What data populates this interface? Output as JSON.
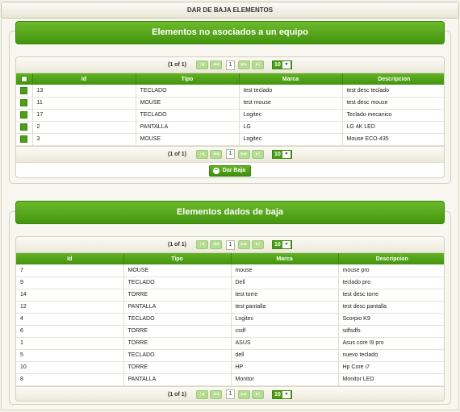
{
  "page": {
    "title": "DAR DE BAJA ELEMENTOS"
  },
  "panel1": {
    "title": "Elementos no asociados a un equipo",
    "pager": {
      "current": "(1 of 1)",
      "page": "1",
      "rows_per_page": "10"
    },
    "columns": [
      "Id",
      "Tipo",
      "Marca",
      "Descripcion"
    ],
    "rows": [
      {
        "id": "13",
        "tipo": "TECLADO",
        "marca": "test teclado",
        "descripcion": "test desc teclado"
      },
      {
        "id": "11",
        "tipo": "MOUSE",
        "marca": "test mouse",
        "descripcion": "test desc mouse"
      },
      {
        "id": "17",
        "tipo": "TECLADO",
        "marca": "Logitec",
        "descripcion": "Teclado mecanico"
      },
      {
        "id": "2",
        "tipo": "PANTALLA",
        "marca": "LG",
        "descripcion": "LG 4K LED"
      },
      {
        "id": "3",
        "tipo": "MOUSE",
        "marca": "Logitec",
        "descripcion": "Mouse ECO-435"
      }
    ],
    "button_label": "Dar Baja"
  },
  "panel2": {
    "title": "Elementos dados de baja",
    "pager": {
      "current": "(1 of 1)",
      "page": "1",
      "rows_per_page": "10"
    },
    "columns": [
      "Id",
      "Tipo",
      "Marca",
      "Descripcion"
    ],
    "rows": [
      {
        "id": "7",
        "tipo": "MOUSE",
        "marca": "mouse",
        "descripcion": "mouse pro"
      },
      {
        "id": "9",
        "tipo": "TECLADO",
        "marca": "Dell",
        "descripcion": "teclado pro"
      },
      {
        "id": "14",
        "tipo": "TORRE",
        "marca": "test torre",
        "descripcion": "test desc torre"
      },
      {
        "id": "12",
        "tipo": "PANTALLA",
        "marca": "test pantalla",
        "descripcion": "test desc pantalla"
      },
      {
        "id": "4",
        "tipo": "TECLADO",
        "marca": "Logitec",
        "descripcion": "Scorpio K9"
      },
      {
        "id": "6",
        "tipo": "TORRE",
        "marca": "csdf",
        "descripcion": "sdfsdfs"
      },
      {
        "id": "1",
        "tipo": "TORRE",
        "marca": "ASUS",
        "descripcion": "Asus core I9 pro"
      },
      {
        "id": "5",
        "tipo": "TECLADO",
        "marca": "dell",
        "descripcion": "nuevo teclado"
      },
      {
        "id": "10",
        "tipo": "TORRE",
        "marca": "HP",
        "descripcion": "Hp Core i7"
      },
      {
        "id": "8",
        "tipo": "PANTALLA",
        "marca": "Monitor",
        "descripcion": "Monitor LED"
      }
    ]
  },
  "icons": {
    "first": "first-page-icon",
    "prev": "prev-page-icon",
    "next": "next-page-icon",
    "last": "last-page-icon",
    "dropdown": "chevron-down-icon",
    "minus": "minus-circle-icon"
  },
  "colors": {
    "accent": "#4c9e16",
    "header_dark": "#43930f",
    "background": "#f4f2e8"
  }
}
